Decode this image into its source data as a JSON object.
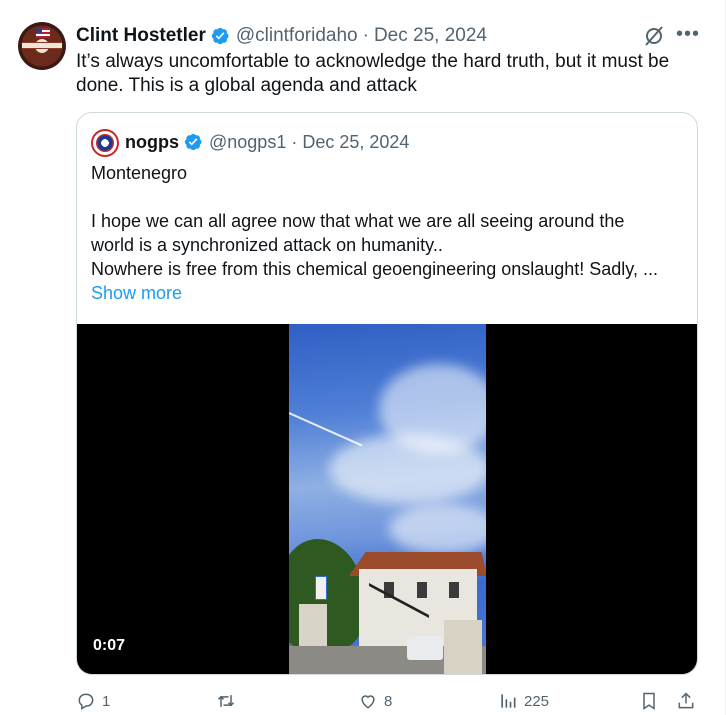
{
  "tweet": {
    "author_name": "Clint Hostetler",
    "author_handle": "@clintforidaho",
    "separator": "·",
    "date": "Dec 25, 2024",
    "text_line1": "It’s always uncomfortable to acknowledge the hard truth, but it must be",
    "text_line2": "done. This is a global agenda and attack"
  },
  "quote": {
    "author_name": "nogps",
    "author_handle": "@nogps1",
    "separator": "·",
    "date": "Dec 25, 2024",
    "line1": "Montenegro",
    "line2": "I hope we can all agree now that what we are all seeing around the",
    "line3": "world is a synchronized attack on humanity..",
    "line4": "Nowhere is free from this chemical geoengineering onslaught! Sadly, ...",
    "show_more": "Show more",
    "video_duration": "0:07"
  },
  "actions": {
    "replies": "1",
    "reposts": "",
    "likes": "8",
    "views": "225"
  },
  "icons": {
    "verified": "verified-badge-icon",
    "grok": "grok-icon",
    "more": "more-icon",
    "reply": "reply-icon",
    "repost": "repost-icon",
    "like": "heart-icon",
    "views": "views-icon",
    "bookmark": "bookmark-icon",
    "share": "share-icon"
  },
  "colors": {
    "accent": "#1d9bf0",
    "secondary_text": "#536471",
    "text": "#0f1419"
  }
}
